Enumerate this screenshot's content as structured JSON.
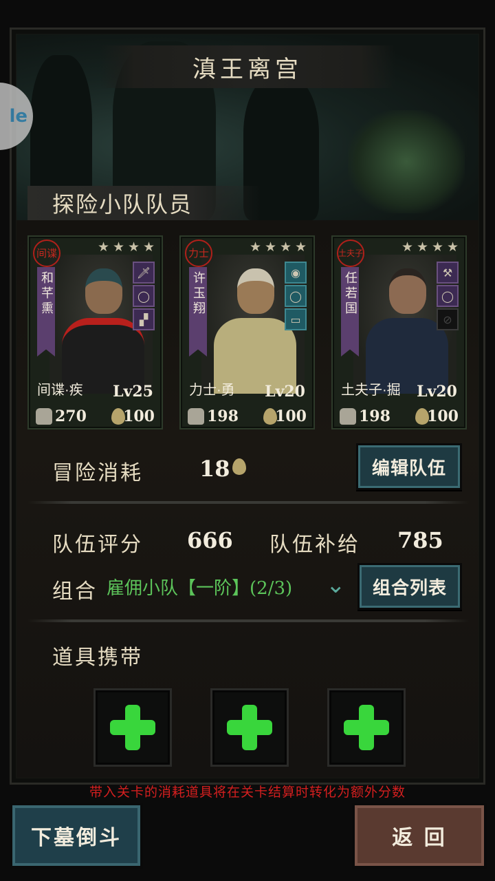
{
  "title": "滇王离宫",
  "side_bubble": "le",
  "section_title": "探险小队队员",
  "members": [
    {
      "seal": "间谍",
      "name": "和芊熏",
      "stars": 4,
      "class_label": "间谍·疾",
      "level": "Lv25",
      "power": "270",
      "stamina": "100",
      "equip": [
        "dagger-icon",
        "ring-icon",
        "boot-icon"
      ]
    },
    {
      "seal": "力士",
      "name": "许玉翔",
      "stars": 4,
      "class_label": "力士·勇",
      "level": "Lv20",
      "power": "198",
      "stamina": "100",
      "equip": [
        "amulet-icon",
        "bracelet-icon",
        "talisman-icon"
      ]
    },
    {
      "seal": "土夫子",
      "name": "任若国",
      "stars": 4,
      "class_label": "土夫子·掘",
      "level": "Lv20",
      "power": "198",
      "stamina": "100",
      "equip": [
        "shovel-icon",
        "ring-icon",
        "empty-slot-icon"
      ]
    }
  ],
  "cost": {
    "label": "冒险消耗",
    "value": "18"
  },
  "edit_team_button": "编辑队伍",
  "team_score": {
    "label": "队伍评分",
    "value": "666"
  },
  "team_supply": {
    "label": "队伍补给",
    "value": "785"
  },
  "combo": {
    "label": "组合",
    "value": "雇佣小队【一阶】(2/3)"
  },
  "combo_list_button": "组合列表",
  "items_label": "道具携带",
  "item_slots": [
    "add-item",
    "add-item",
    "add-item"
  ],
  "notice": "带入关卡的消耗道具将在关卡结算时转化为额外分数",
  "descend_button": "下墓倒斗",
  "back_button": "返 回",
  "colors": {
    "accent_green": "#39d63c",
    "notice_red": "#d41f1f",
    "button_teal": "#1e3a42",
    "back_brown": "#5a3a30"
  }
}
